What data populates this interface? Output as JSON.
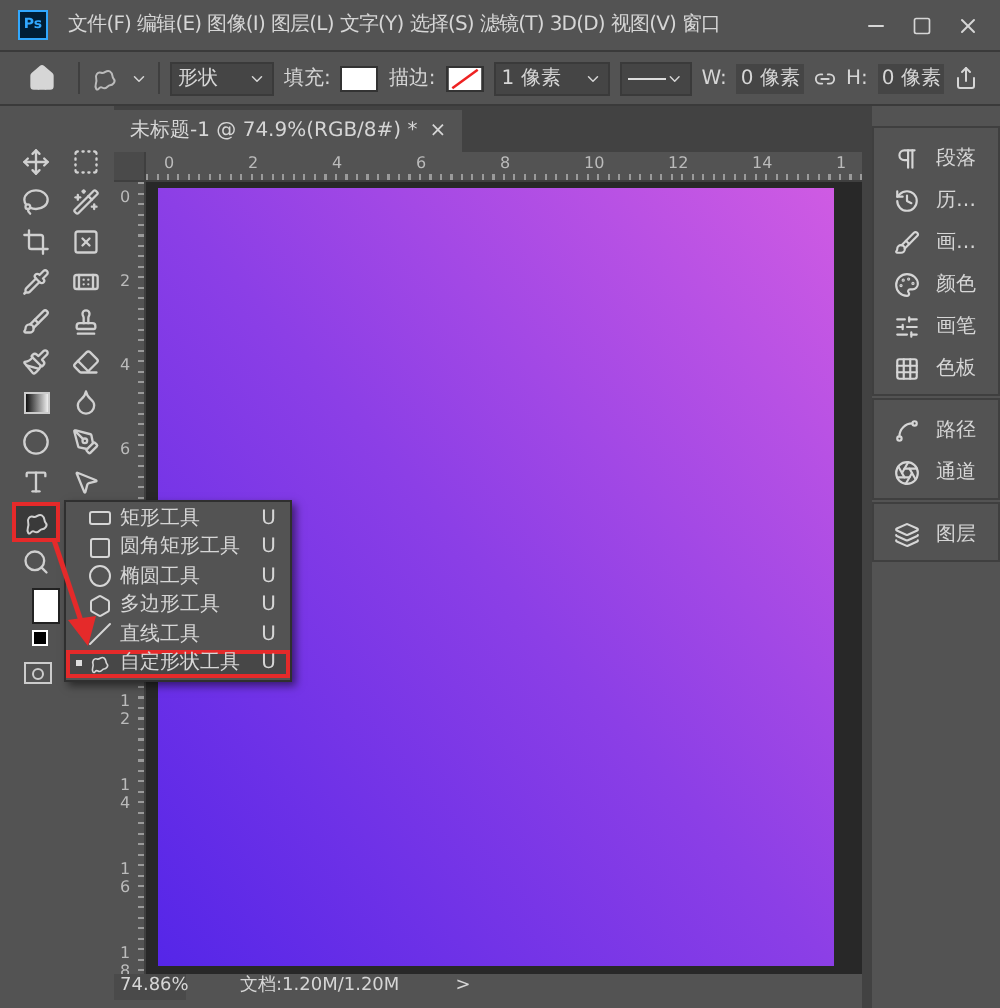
{
  "app": {
    "logo": "Ps"
  },
  "menu": [
    "文件(F)",
    "编辑(E)",
    "图像(I)",
    "图层(L)",
    "文字(Y)",
    "选择(S)",
    "滤镜(T)",
    "3D(D)",
    "视图(V)",
    "窗口"
  ],
  "options": {
    "shape_mode": "形状",
    "fill_label": "填充:",
    "stroke_label": "描边:",
    "stroke_width": "1 像素",
    "w_label": "W:",
    "w_value": "0 像素",
    "h_label": "H:",
    "h_value": "0 像素"
  },
  "document_tab": {
    "title": "未标题-1 @ 74.9%(RGB/8#) *",
    "close": "×"
  },
  "horizontal_ruler": [
    "0",
    "2",
    "4",
    "6",
    "8",
    "10",
    "12",
    "14",
    "1"
  ],
  "vertical_ruler": {
    "upper": [
      "0",
      "2",
      "4",
      "6"
    ],
    "lower": [
      "12",
      "14",
      "16",
      "18"
    ]
  },
  "tools": [
    {
      "selected": false
    },
    {
      "selected": false
    },
    {
      "selected": false
    },
    {
      "selected": false
    },
    {
      "selected": false
    },
    {
      "selected": false
    },
    {
      "selected": false
    },
    {
      "selected": false
    },
    {
      "selected": false
    },
    {
      "selected": false
    },
    {
      "selected": false
    },
    {
      "selected": false
    },
    {
      "selected": false
    },
    {
      "selected": false
    },
    {
      "selected": false
    },
    {
      "selected": false
    },
    {
      "selected": false
    },
    {
      "selected": false
    },
    {
      "selected": true
    },
    {
      "selected": false
    }
  ],
  "flyout": [
    {
      "label": "矩形工具",
      "shortcut": "U",
      "selected": false
    },
    {
      "label": "圆角矩形工具",
      "shortcut": "U",
      "selected": false
    },
    {
      "label": "椭圆工具",
      "shortcut": "U",
      "selected": false
    },
    {
      "label": "多边形工具",
      "shortcut": "U",
      "selected": false
    },
    {
      "label": "直线工具",
      "shortcut": "U",
      "selected": false
    },
    {
      "label": "自定形状工具",
      "shortcut": "U",
      "selected": true
    }
  ],
  "panels": [
    [
      {
        "label": "段落"
      },
      {
        "label": "历…"
      },
      {
        "label": "画…"
      },
      {
        "label": "颜色"
      },
      {
        "label": "画笔"
      },
      {
        "label": "色板"
      }
    ],
    [
      {
        "label": "路径"
      },
      {
        "label": "通道"
      }
    ],
    [
      {
        "label": "图层"
      }
    ]
  ],
  "status_bar": {
    "zoom": "74.86%",
    "document": "文档:1.20M/1.20M",
    "arrow": ">"
  }
}
